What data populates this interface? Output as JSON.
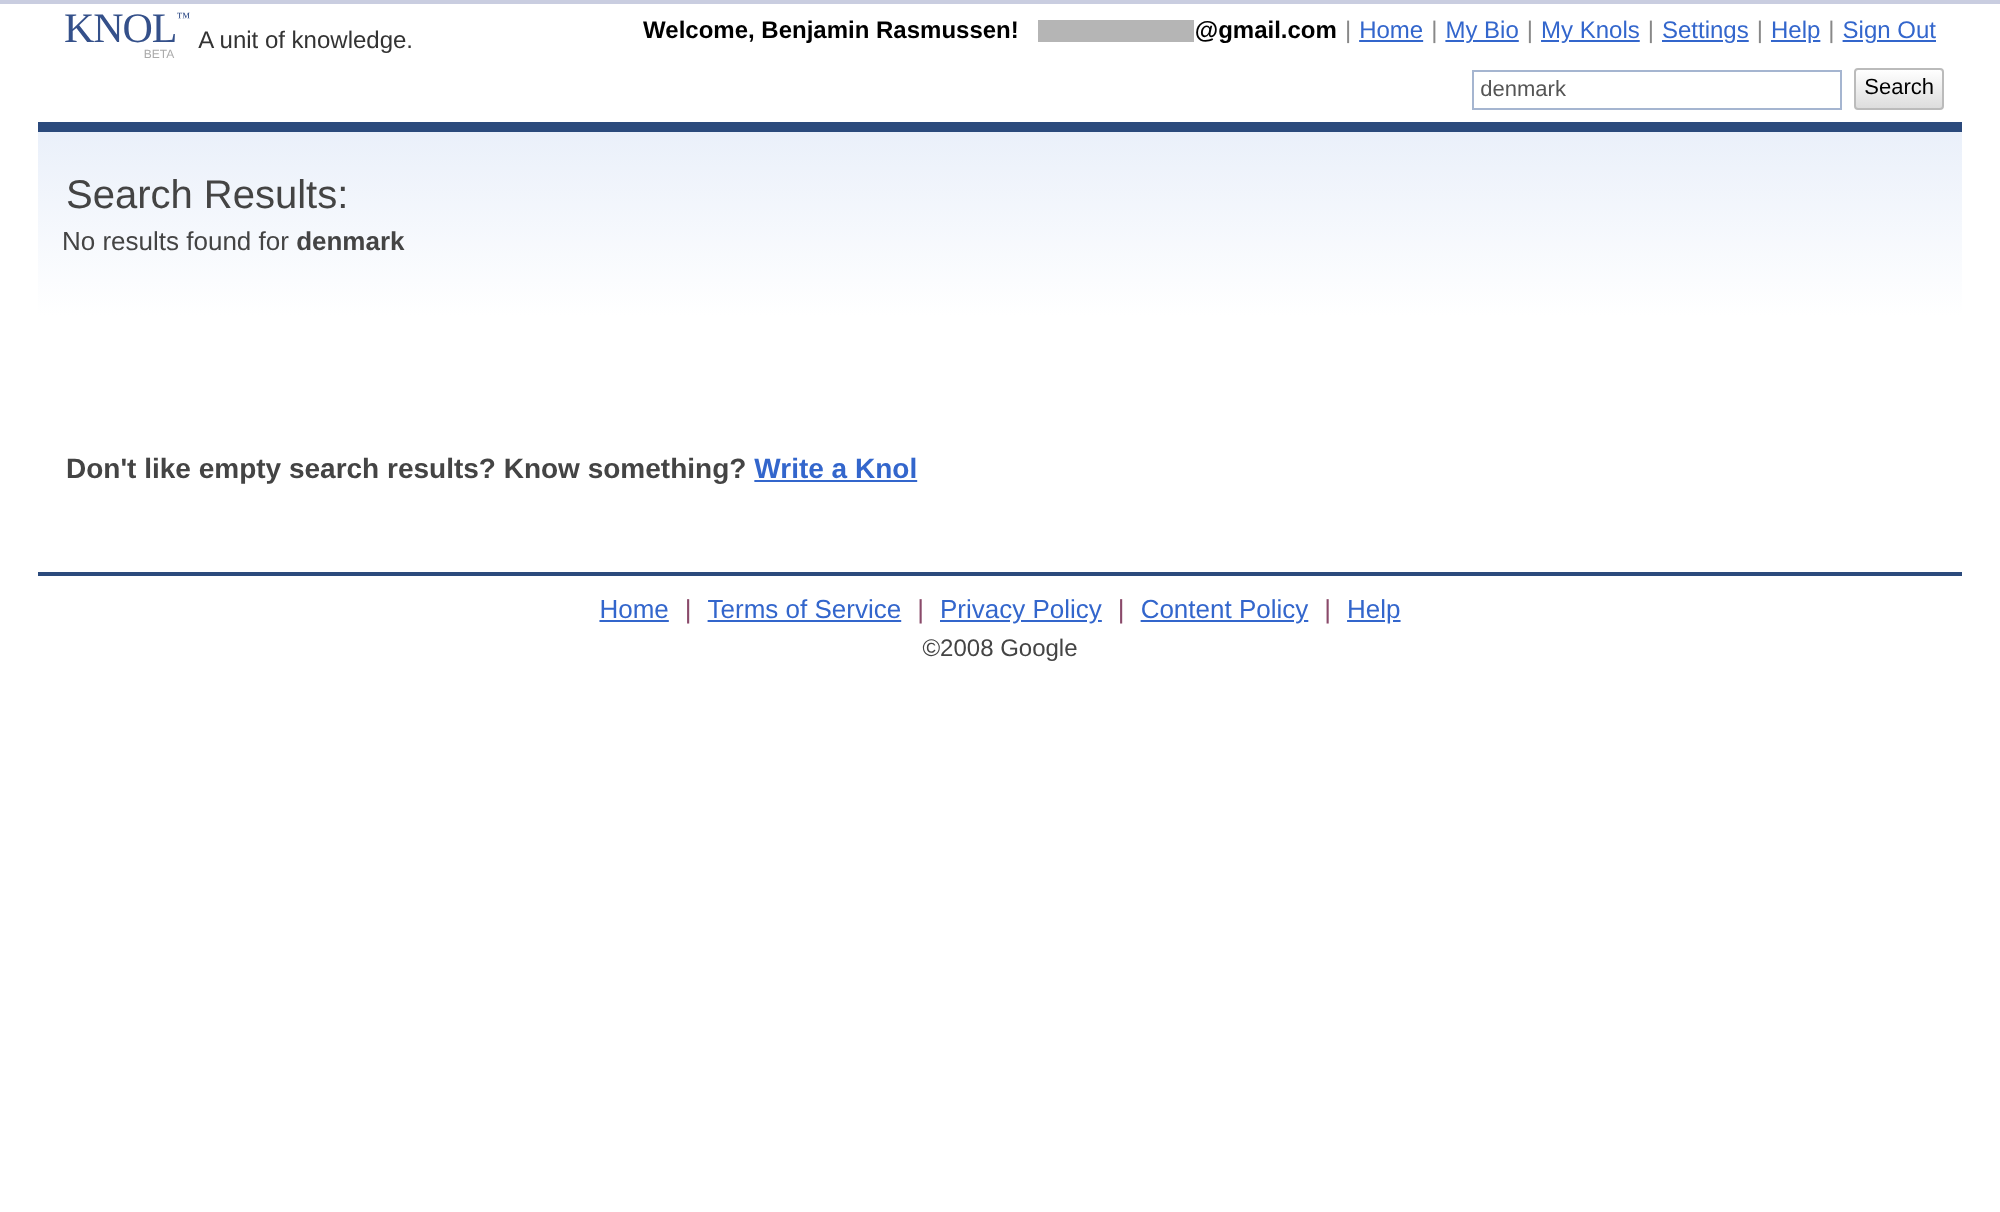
{
  "header": {
    "logo": {
      "word": "KNOL",
      "mark": "™",
      "badge": "BETA"
    },
    "tagline": "A unit of knowledge.",
    "welcome": "Welcome, Benjamin Rasmussen!",
    "email_visible": "@gmail.com",
    "separator": "|",
    "links": [
      "Home",
      "My Bio",
      "My Knols",
      "Settings",
      "Help",
      "Sign Out"
    ],
    "search": {
      "value": "denmark",
      "button": "Search"
    }
  },
  "results": {
    "title": "Search Results:",
    "message": "No results found for **denmark**"
  },
  "prompt": {
    "text": "Don't like empty search results? Know something?",
    "link": "Write a Knol"
  },
  "footer": {
    "separator": "|",
    "links": [
      "Home",
      "Terms of Service",
      "Privacy Policy",
      "Content Policy",
      "Help"
    ],
    "copyright": "©2008 Google"
  }
}
